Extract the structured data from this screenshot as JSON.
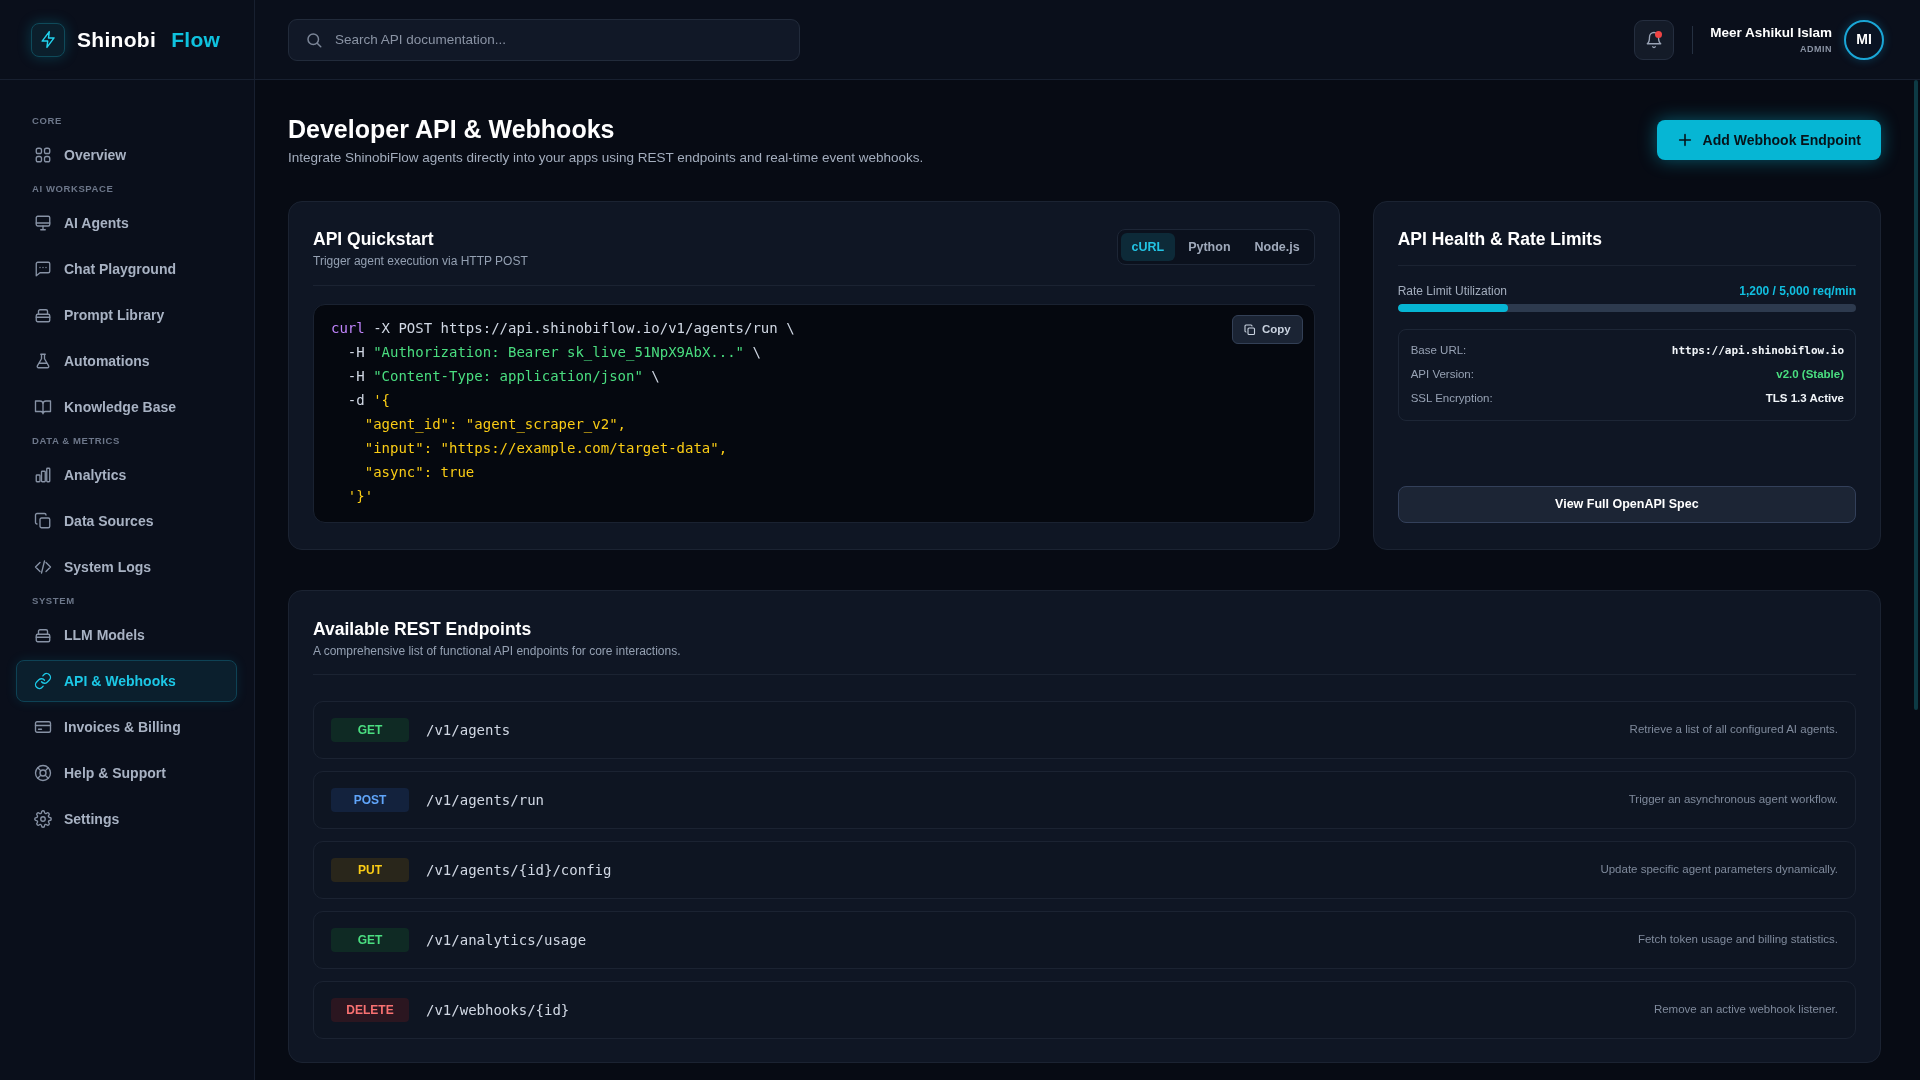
{
  "sidebar": {
    "brand": {
      "name": "Shinobi",
      "accent": "Flow"
    },
    "sections": [
      {
        "label": "CORE",
        "items": [
          {
            "label": "Overview",
            "selected": false
          }
        ]
      },
      {
        "label": "AI WORKSPACE",
        "items": [
          {
            "label": "AI Agents",
            "selected": false
          },
          {
            "label": "Chat Playground",
            "selected": false
          },
          {
            "label": "Prompt Library",
            "selected": false
          },
          {
            "label": "Automations",
            "selected": false
          },
          {
            "label": "Knowledge Base",
            "selected": false
          }
        ]
      },
      {
        "label": "DATA & METRICS",
        "items": [
          {
            "label": "Analytics",
            "selected": false
          },
          {
            "label": "Data Sources",
            "selected": false
          },
          {
            "label": "System Logs",
            "selected": false
          }
        ]
      },
      {
        "label": "SYSTEM",
        "items": [
          {
            "label": "LLM Models",
            "selected": false
          },
          {
            "label": "API & Webhooks",
            "selected": true
          },
          {
            "label": "Invoices & Billing",
            "selected": false
          },
          {
            "label": "Help & Support",
            "selected": false
          },
          {
            "label": "Settings",
            "selected": false
          }
        ]
      }
    ]
  },
  "header": {
    "search": {
      "placeholder": "Search API documentation..."
    },
    "notifications": {
      "unread": true
    },
    "user": {
      "name": "Meer Ashikul Islam",
      "role": "ADMIN",
      "initials": "MI"
    }
  },
  "page": {
    "title": "Developer API & Webhooks",
    "subtitle": "Integrate ShinobiFlow agents directly into your apps using REST endpoints and real-time event webhooks.",
    "action": "Add Webhook Endpoint"
  },
  "quickstart": {
    "title": "API Quickstart",
    "subtitle": "Trigger agent execution via HTTP POST",
    "tabs": [
      {
        "label": "cURL",
        "selected": true
      },
      {
        "label": "Python",
        "selected": false
      },
      {
        "label": "Node.js",
        "selected": false
      }
    ],
    "copy_label": "Copy",
    "code": [
      {
        "segments": [
          {
            "kind": "command",
            "text": "curl"
          },
          {
            "kind": "plain",
            "text": " -X POST https://api.shinobiflow.io/v1/agents/run \\"
          }
        ]
      },
      {
        "segments": [
          {
            "kind": "plain",
            "text": "  -H "
          },
          {
            "kind": "string",
            "text": "\"Authorization: Bearer sk_live_51NpX9AbX...\""
          },
          {
            "kind": "plain",
            "text": " \\"
          }
        ]
      },
      {
        "segments": [
          {
            "kind": "plain",
            "text": "  -H "
          },
          {
            "kind": "string",
            "text": "\"Content-Type: application/json\""
          },
          {
            "kind": "plain",
            "text": " \\"
          }
        ]
      },
      {
        "segments": [
          {
            "kind": "plain",
            "text": "  -d "
          },
          {
            "kind": "json",
            "text": "'{"
          }
        ]
      },
      {
        "segments": [
          {
            "kind": "json",
            "text": "    \"agent_id\": \"agent_scraper_v2\","
          }
        ]
      },
      {
        "segments": [
          {
            "kind": "json",
            "text": "    \"input\": \"https://example.com/target-data\","
          }
        ]
      },
      {
        "segments": [
          {
            "kind": "json",
            "text": "    \"async\": true"
          }
        ]
      },
      {
        "segments": [
          {
            "kind": "json",
            "text": "  '}'"
          }
        ]
      }
    ]
  },
  "health": {
    "title": "API Health & Rate Limits",
    "rate_limit": {
      "label": "Rate Limit Utilization",
      "reading": "1,200 / 5,000 req/min",
      "level": 0.24
    },
    "details": [
      {
        "label": "Base URL:",
        "value": "https://api.shinobiflow.io",
        "kind": "code"
      },
      {
        "label": "API Version:",
        "value": "v2.0 (Stable)",
        "kind": "status"
      },
      {
        "label": "SSL Encryption:",
        "value": "TLS 1.3 Active",
        "kind": "text"
      }
    ],
    "button": "View Full OpenAPI Spec"
  },
  "endpoints": {
    "title": "Available REST Endpoints",
    "subtitle": "A comprehensive list of functional API endpoints for core interactions.",
    "rows": [
      {
        "method": "GET",
        "kind": "get",
        "path": "/v1/agents",
        "description": "Retrieve a list of all configured AI agents."
      },
      {
        "method": "POST",
        "kind": "post",
        "path": "/v1/agents/run",
        "description": "Trigger an asynchronous agent workflow."
      },
      {
        "method": "PUT",
        "kind": "put",
        "path": "/v1/agents/{id}/config",
        "description": "Update specific agent parameters dynamically."
      },
      {
        "method": "GET",
        "kind": "get",
        "path": "/v1/analytics/usage",
        "description": "Fetch token usage and billing statistics."
      },
      {
        "method": "DELETE",
        "kind": "delete",
        "path": "/v1/webhooks/{id}",
        "description": "Remove an active webhook listener."
      }
    ]
  }
}
